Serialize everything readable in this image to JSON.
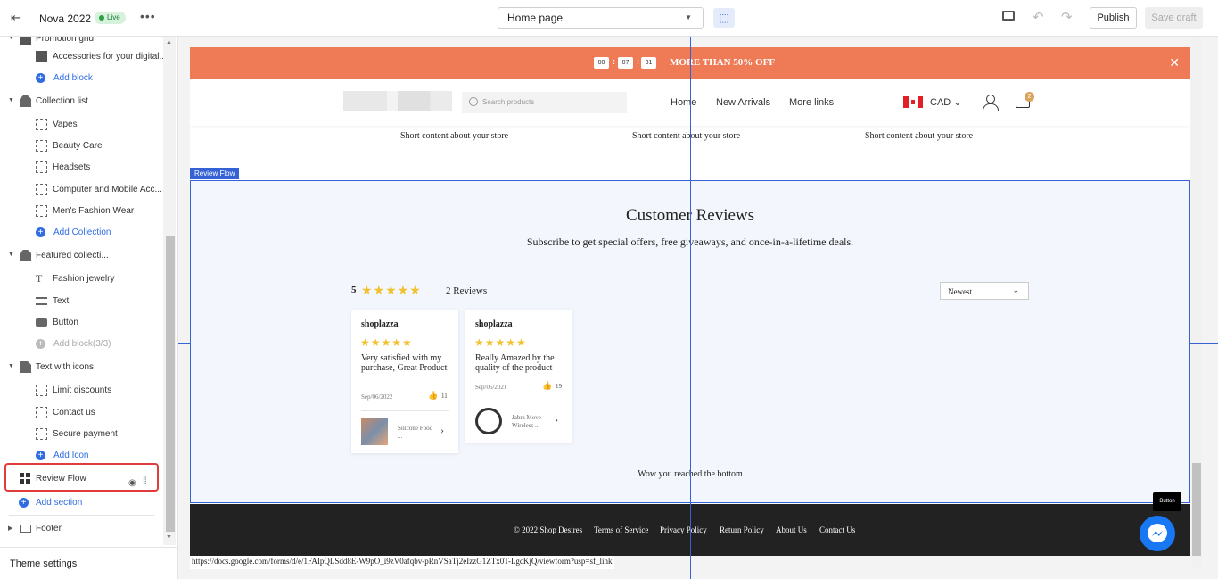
{
  "topbar": {
    "store_name": "Nova 2022",
    "live_badge": "Live",
    "more_label": "•••",
    "page_select": "Home page",
    "publish_label": "Publish",
    "save_draft_label": "Save draft"
  },
  "sidebar": {
    "partial_top": "Promotion grid",
    "items": [
      {
        "kind": "block",
        "label": "Accessories for your digital..."
      },
      {
        "kind": "add",
        "label": "Add block"
      },
      {
        "kind": "section",
        "label": "Collection list"
      },
      {
        "kind": "block",
        "label": "Vapes"
      },
      {
        "kind": "block",
        "label": "Beauty Care"
      },
      {
        "kind": "block",
        "label": "Headsets"
      },
      {
        "kind": "block",
        "label": "Computer and Mobile Acc..."
      },
      {
        "kind": "block",
        "label": "Men's Fashion Wear"
      },
      {
        "kind": "add",
        "label": "Add Collection"
      },
      {
        "kind": "section",
        "label": "Featured collecti..."
      },
      {
        "kind": "block",
        "label": "Fashion jewelry"
      },
      {
        "kind": "block",
        "label": "Text"
      },
      {
        "kind": "block",
        "label": "Button"
      },
      {
        "kind": "add",
        "label": "Add block(3/3)"
      },
      {
        "kind": "section",
        "label": "Text with icons"
      },
      {
        "kind": "block",
        "label": "Limit discounts"
      },
      {
        "kind": "block",
        "label": "Contact us"
      },
      {
        "kind": "block",
        "label": "Secure payment"
      },
      {
        "kind": "add",
        "label": "Add Icon"
      },
      {
        "kind": "section",
        "label": "Review Flow"
      },
      {
        "kind": "add",
        "label": "Add section"
      },
      {
        "kind": "section",
        "label": "Footer"
      }
    ],
    "theme_settings": "Theme settings"
  },
  "preview": {
    "countdown": [
      "00",
      "07",
      "31"
    ],
    "promo_text": "MORE THAN 50% OFF",
    "search_placeholder": "Search products",
    "nav": [
      "Home",
      "New Arrivals",
      "More links"
    ],
    "currency": "CAD",
    "cart_count": "2",
    "short_content": [
      "Short content about your store",
      "Short content about your store",
      "Short content about your store"
    ],
    "section_tag": "Review Flow",
    "reviews_title": "Customer Reviews",
    "reviews_subtitle": "Subscribe to get special offers, free giveaways, and once-in-a-lifetime deals.",
    "average": "5",
    "review_count": "2 Reviews",
    "sort": "Newest",
    "reviews": [
      {
        "user": "shoplazza",
        "stars": 5,
        "text": "Very satisfied with my purchase, Great Product",
        "date": "Sep/06/2022",
        "likes": "11",
        "product": "Silicone Food ..."
      },
      {
        "user": "shoplazza",
        "stars": 5,
        "text": "Really Amazed by the quality of the product",
        "date": "Sep/05/2021",
        "likes": "19",
        "product": "Jabra Move Wireless ..."
      }
    ],
    "bottom_text": "Wow you reached the bottom",
    "footer_links": [
      "© 2022 Shop Desires",
      "Terms of Service",
      "Privacy Policy",
      "Return Policy",
      "About Us",
      "Contact Us"
    ],
    "button_tooltip": "Button",
    "status_url": "https://docs.google.com/forms/d/e/1FAIpQLSdd8E-W9pO_i9zV0afqbv-pRnVSaTj2eIzzG1ZTx0T-LgcKjQ/viewform?usp=sf_link"
  },
  "colors": {
    "accent": "#3563d6",
    "promo_bar": "#ee7b56",
    "star": "#f2c12e",
    "highlight_border": "#e23b3b"
  }
}
